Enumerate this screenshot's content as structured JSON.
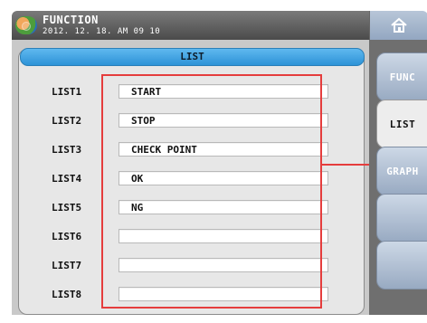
{
  "header": {
    "title": "FUNCTION",
    "datetime": "2012. 12. 18. AM 09 10"
  },
  "icons": {
    "app_logo": "app-logo-icon",
    "home": "home-icon"
  },
  "panel": {
    "title": "LIST",
    "rows": [
      {
        "label": "LIST1",
        "value": "START"
      },
      {
        "label": "LIST2",
        "value": "STOP"
      },
      {
        "label": "LIST3",
        "value": "CHECK POINT"
      },
      {
        "label": "LIST4",
        "value": "OK"
      },
      {
        "label": "LIST5",
        "value": "NG"
      },
      {
        "label": "LIST6",
        "value": ""
      },
      {
        "label": "LIST7",
        "value": ""
      },
      {
        "label": "LIST8",
        "value": ""
      }
    ]
  },
  "tabs": [
    {
      "label": "FUNC"
    },
    {
      "label": "LIST"
    },
    {
      "label": "GRAPH"
    }
  ],
  "colors": {
    "accent_blue": "#2d93d7",
    "highlight_red": "#e53d3d"
  }
}
